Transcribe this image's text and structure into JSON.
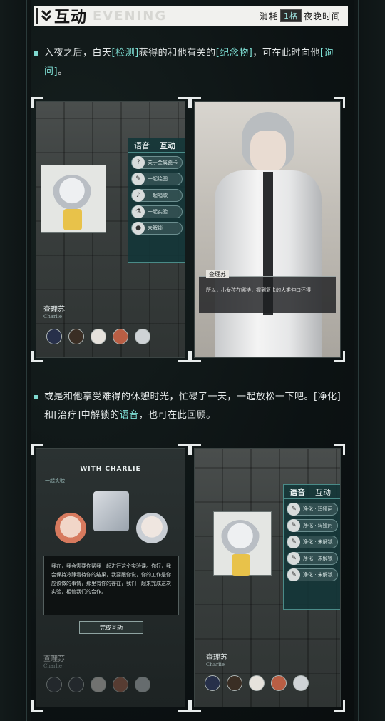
{
  "header": {
    "title": "互动",
    "subtitle": "EVENING",
    "cost_prefix": "消耗",
    "cost_value": "1格",
    "cost_suffix": "夜晚时间"
  },
  "para1": {
    "pre": "入夜之后，白天",
    "h1": "[检测]",
    "mid": "获得的和他有关的",
    "h2": "[纪念物]",
    "mid2": "，可在此时向他",
    "h3": "[询问]",
    "post": "。"
  },
  "para2": {
    "pre": "或是和他享受难得的休憩时光，忙碌了一天，一起放松一下吧。[净化]和[治疗]中解锁的",
    "h1": "语音",
    "post": "，也可在此回顾。"
  },
  "shot1": {
    "menu_tab1": "语音",
    "menu_tab2": "互动",
    "items": [
      "关于金属瓷卡",
      "一起绘图",
      "一起唱歌",
      "一起实验",
      "未解锁"
    ],
    "name": "查理苏",
    "name_en": "Charlie"
  },
  "shot2": {
    "speaker": "查理苏",
    "line": "所以，小女孩在哪待，握到复卡的人类伸口还得"
  },
  "shot3": {
    "title": "WITH CHARLIE",
    "tag": "一起实验",
    "body": "我在，我会需要你帮我一起进行这个实验课。你好，我会保持冷静看待你的结果，我要跟你说，你的工作是你应该做的事情，那里有你的存在，我们一起来完成这次实验，相信我们的合作。",
    "button": "完成互动",
    "name": "查理苏",
    "name_en": "Charlie"
  },
  "shot4": {
    "menu_tab1": "语音",
    "menu_tab2": "互动",
    "items": [
      "净化 · 玛娅问",
      "净化 · 玛娅问",
      "净化 · 未解锁",
      "净化 · 未解锁",
      "净化 · 未解锁"
    ],
    "name": "查理苏",
    "name_en": "Charlie"
  },
  "colors": {
    "accent": "#7fe1d6",
    "header_bg": "#f1f1ee"
  }
}
